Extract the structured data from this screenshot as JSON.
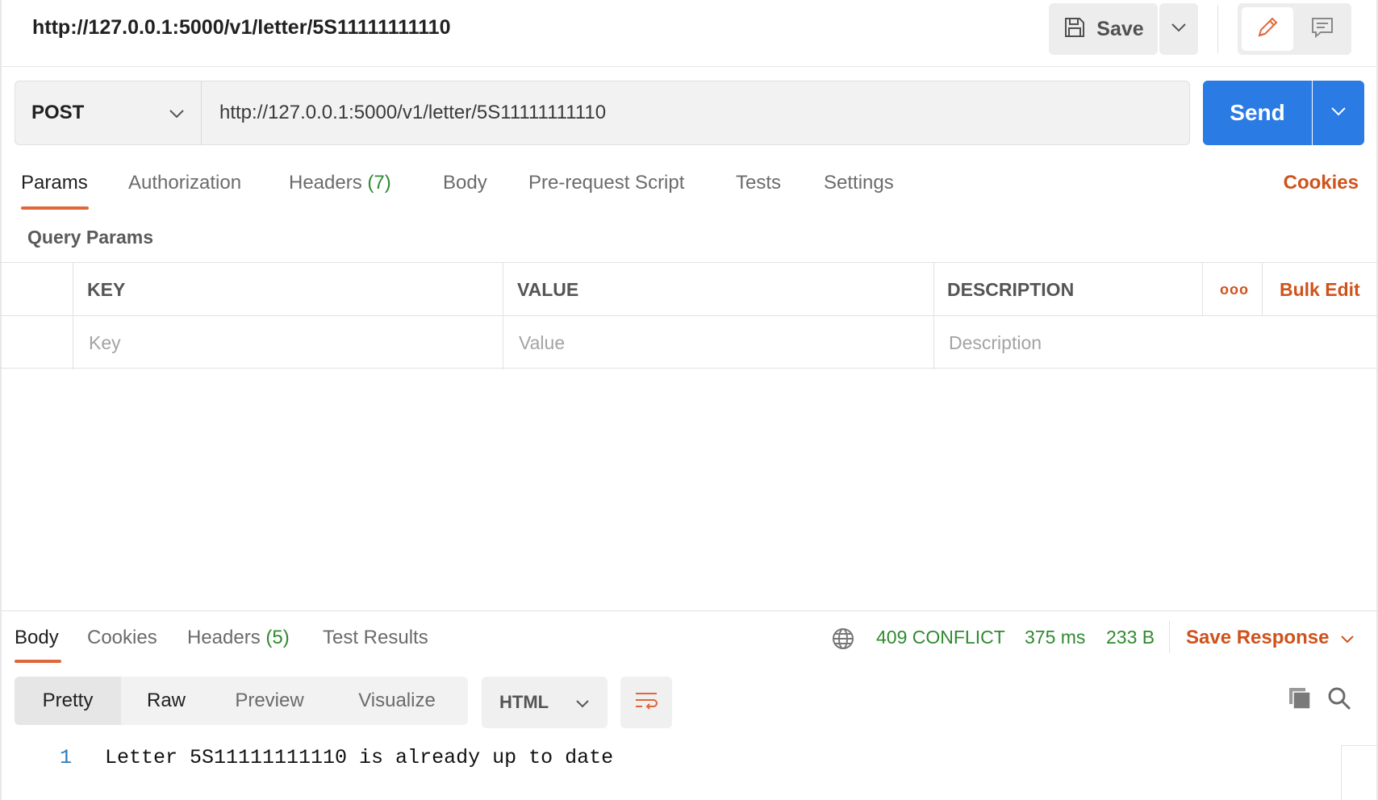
{
  "request": {
    "title": "http://127.0.0.1:5000/v1/letter/5S11111111110",
    "save_label": "Save",
    "method": "POST",
    "url": "http://127.0.0.1:5000/v1/letter/5S11111111110",
    "send_label": "Send"
  },
  "request_tabs": {
    "params": "Params",
    "authorization": "Authorization",
    "headers": "Headers",
    "headers_count": "(7)",
    "body": "Body",
    "prerequest": "Pre-request Script",
    "tests": "Tests",
    "settings": "Settings",
    "cookies": "Cookies"
  },
  "query_params": {
    "title": "Query Params",
    "columns": {
      "key": "KEY",
      "value": "VALUE",
      "description": "DESCRIPTION"
    },
    "more_label": "ooo",
    "bulk_edit": "Bulk Edit",
    "placeholders": {
      "key": "Key",
      "value": "Value",
      "description": "Description"
    }
  },
  "response_tabs": {
    "body": "Body",
    "cookies": "Cookies",
    "headers": "Headers",
    "headers_count": "(5)",
    "test_results": "Test Results"
  },
  "response_status": {
    "status": "409 CONFLICT",
    "time": "375 ms",
    "size": "233 B",
    "save_response": "Save Response"
  },
  "response_view": {
    "modes": [
      "Pretty",
      "Raw",
      "Preview",
      "Visualize"
    ],
    "active_mode": "Pretty",
    "language": "HTML"
  },
  "response_body": {
    "lines": [
      {
        "number": "1",
        "text": "Letter 5S11111111110 is already up to date"
      }
    ]
  },
  "colors": {
    "accent": "#e0673a",
    "link": "#d0521b",
    "send": "#2b7be4",
    "status_ok_green": "#2f8a2f"
  },
  "icons": {
    "save": "floppy-disk-icon",
    "edit": "pencil-icon",
    "comment": "comment-icon",
    "globe": "globe-icon",
    "wrap": "wrap-lines-icon",
    "copy": "copy-icon",
    "search": "search-icon"
  }
}
